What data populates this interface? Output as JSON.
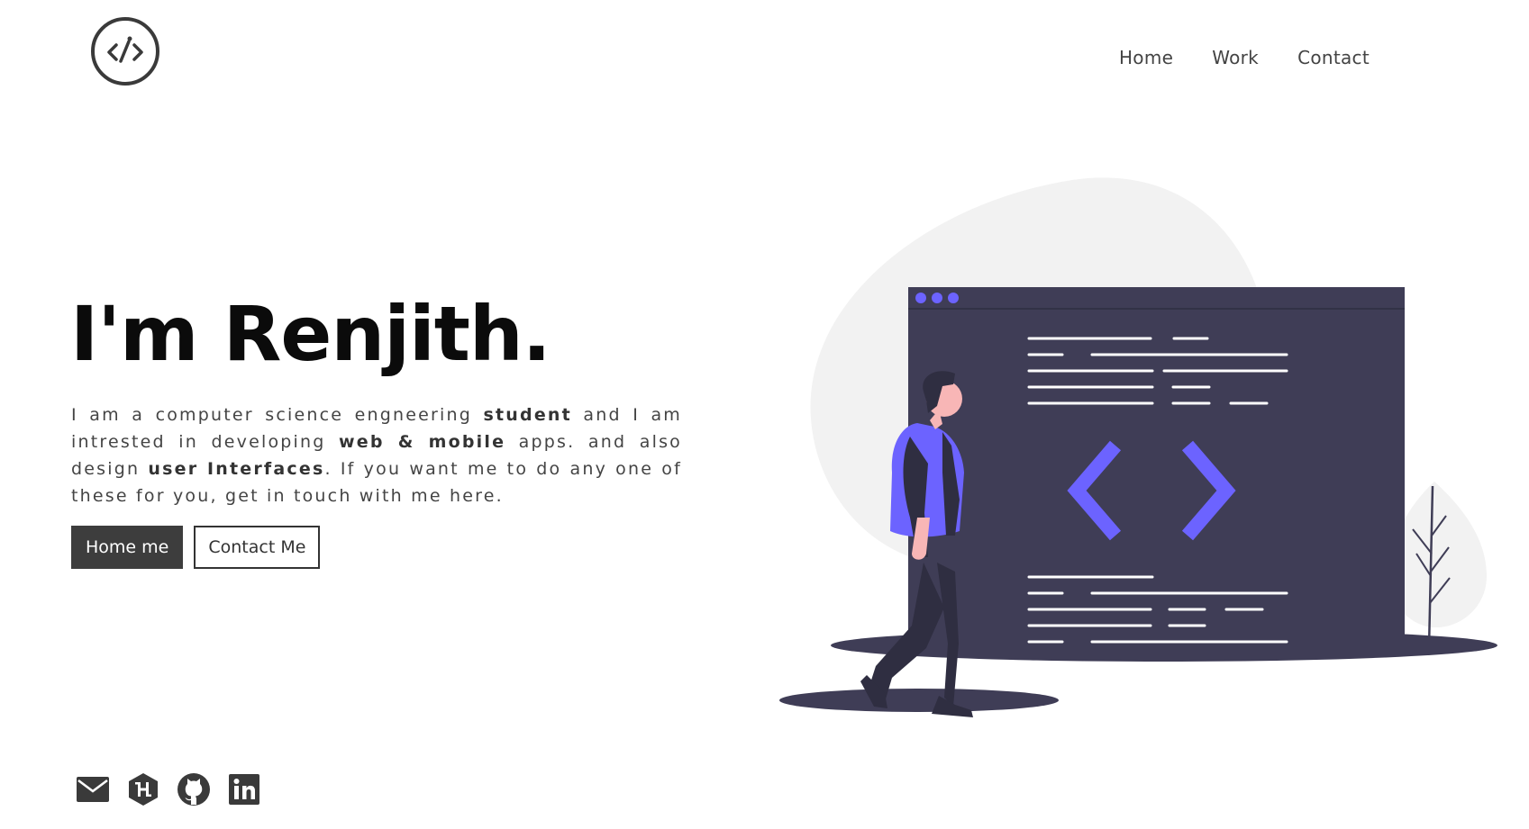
{
  "header": {
    "logo_icon": "code-pen-circle-icon",
    "nav": [
      {
        "label": "Home"
      },
      {
        "label": "Work"
      },
      {
        "label": "Contact"
      }
    ]
  },
  "hero": {
    "title": "I'm Renjith.",
    "intro": {
      "p1": "I am a computer science engneering ",
      "b1": "student",
      "p2": " and I am intrested in developing ",
      "b2": "web & mobile",
      "p3": " apps. and also design ",
      "b3": "user Interfaces",
      "p4": ". If you want me to do any one of these for you, get in touch with me here."
    },
    "buttons": {
      "primary_label": "Home me",
      "secondary_label": "Contact Me"
    }
  },
  "socials": [
    {
      "icon": "mail-icon"
    },
    {
      "icon": "hashnode-icon"
    },
    {
      "icon": "github-icon"
    },
    {
      "icon": "linkedin-icon"
    }
  ],
  "colors": {
    "accent": "#6c63ff",
    "dark": "#3f3d56",
    "text": "#3a3a3a",
    "blob": "#f2f2f2"
  }
}
